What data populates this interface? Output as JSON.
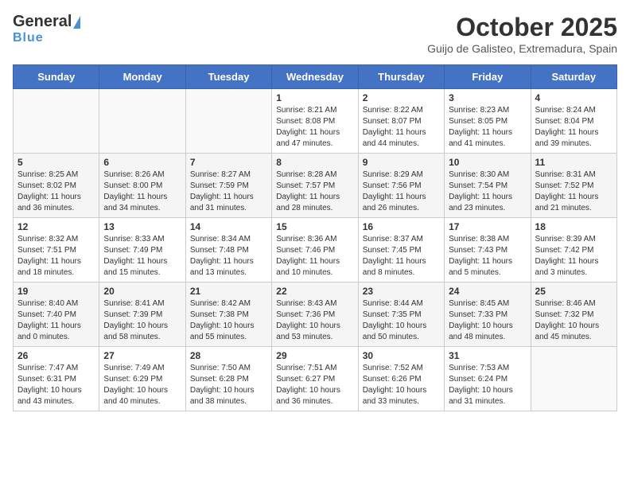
{
  "header": {
    "logo_general": "General",
    "logo_blue": "Blue",
    "month": "October 2025",
    "location": "Guijo de Galisteo, Extremadura, Spain"
  },
  "days_of_week": [
    "Sunday",
    "Monday",
    "Tuesday",
    "Wednesday",
    "Thursday",
    "Friday",
    "Saturday"
  ],
  "weeks": [
    [
      {
        "day": "",
        "info": ""
      },
      {
        "day": "",
        "info": ""
      },
      {
        "day": "",
        "info": ""
      },
      {
        "day": "1",
        "info": "Sunrise: 8:21 AM\nSunset: 8:08 PM\nDaylight: 11 hours and 47 minutes."
      },
      {
        "day": "2",
        "info": "Sunrise: 8:22 AM\nSunset: 8:07 PM\nDaylight: 11 hours and 44 minutes."
      },
      {
        "day": "3",
        "info": "Sunrise: 8:23 AM\nSunset: 8:05 PM\nDaylight: 11 hours and 41 minutes."
      },
      {
        "day": "4",
        "info": "Sunrise: 8:24 AM\nSunset: 8:04 PM\nDaylight: 11 hours and 39 minutes."
      }
    ],
    [
      {
        "day": "5",
        "info": "Sunrise: 8:25 AM\nSunset: 8:02 PM\nDaylight: 11 hours and 36 minutes."
      },
      {
        "day": "6",
        "info": "Sunrise: 8:26 AM\nSunset: 8:00 PM\nDaylight: 11 hours and 34 minutes."
      },
      {
        "day": "7",
        "info": "Sunrise: 8:27 AM\nSunset: 7:59 PM\nDaylight: 11 hours and 31 minutes."
      },
      {
        "day": "8",
        "info": "Sunrise: 8:28 AM\nSunset: 7:57 PM\nDaylight: 11 hours and 28 minutes."
      },
      {
        "day": "9",
        "info": "Sunrise: 8:29 AM\nSunset: 7:56 PM\nDaylight: 11 hours and 26 minutes."
      },
      {
        "day": "10",
        "info": "Sunrise: 8:30 AM\nSunset: 7:54 PM\nDaylight: 11 hours and 23 minutes."
      },
      {
        "day": "11",
        "info": "Sunrise: 8:31 AM\nSunset: 7:52 PM\nDaylight: 11 hours and 21 minutes."
      }
    ],
    [
      {
        "day": "12",
        "info": "Sunrise: 8:32 AM\nSunset: 7:51 PM\nDaylight: 11 hours and 18 minutes."
      },
      {
        "day": "13",
        "info": "Sunrise: 8:33 AM\nSunset: 7:49 PM\nDaylight: 11 hours and 15 minutes."
      },
      {
        "day": "14",
        "info": "Sunrise: 8:34 AM\nSunset: 7:48 PM\nDaylight: 11 hours and 13 minutes."
      },
      {
        "day": "15",
        "info": "Sunrise: 8:36 AM\nSunset: 7:46 PM\nDaylight: 11 hours and 10 minutes."
      },
      {
        "day": "16",
        "info": "Sunrise: 8:37 AM\nSunset: 7:45 PM\nDaylight: 11 hours and 8 minutes."
      },
      {
        "day": "17",
        "info": "Sunrise: 8:38 AM\nSunset: 7:43 PM\nDaylight: 11 hours and 5 minutes."
      },
      {
        "day": "18",
        "info": "Sunrise: 8:39 AM\nSunset: 7:42 PM\nDaylight: 11 hours and 3 minutes."
      }
    ],
    [
      {
        "day": "19",
        "info": "Sunrise: 8:40 AM\nSunset: 7:40 PM\nDaylight: 11 hours and 0 minutes."
      },
      {
        "day": "20",
        "info": "Sunrise: 8:41 AM\nSunset: 7:39 PM\nDaylight: 10 hours and 58 minutes."
      },
      {
        "day": "21",
        "info": "Sunrise: 8:42 AM\nSunset: 7:38 PM\nDaylight: 10 hours and 55 minutes."
      },
      {
        "day": "22",
        "info": "Sunrise: 8:43 AM\nSunset: 7:36 PM\nDaylight: 10 hours and 53 minutes."
      },
      {
        "day": "23",
        "info": "Sunrise: 8:44 AM\nSunset: 7:35 PM\nDaylight: 10 hours and 50 minutes."
      },
      {
        "day": "24",
        "info": "Sunrise: 8:45 AM\nSunset: 7:33 PM\nDaylight: 10 hours and 48 minutes."
      },
      {
        "day": "25",
        "info": "Sunrise: 8:46 AM\nSunset: 7:32 PM\nDaylight: 10 hours and 45 minutes."
      }
    ],
    [
      {
        "day": "26",
        "info": "Sunrise: 7:47 AM\nSunset: 6:31 PM\nDaylight: 10 hours and 43 minutes."
      },
      {
        "day": "27",
        "info": "Sunrise: 7:49 AM\nSunset: 6:29 PM\nDaylight: 10 hours and 40 minutes."
      },
      {
        "day": "28",
        "info": "Sunrise: 7:50 AM\nSunset: 6:28 PM\nDaylight: 10 hours and 38 minutes."
      },
      {
        "day": "29",
        "info": "Sunrise: 7:51 AM\nSunset: 6:27 PM\nDaylight: 10 hours and 36 minutes."
      },
      {
        "day": "30",
        "info": "Sunrise: 7:52 AM\nSunset: 6:26 PM\nDaylight: 10 hours and 33 minutes."
      },
      {
        "day": "31",
        "info": "Sunrise: 7:53 AM\nSunset: 6:24 PM\nDaylight: 10 hours and 31 minutes."
      },
      {
        "day": "",
        "info": ""
      }
    ]
  ]
}
